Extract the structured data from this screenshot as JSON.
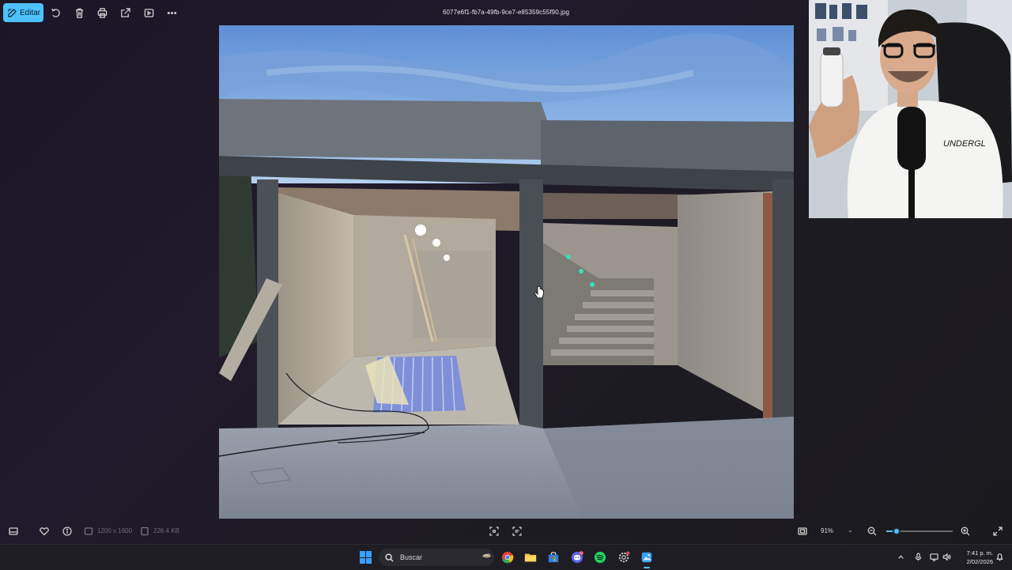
{
  "toolbar": {
    "edit_label": "Editar",
    "icons": [
      "rotate-icon",
      "delete-icon",
      "print-icon",
      "share-icon",
      "slideshow-icon",
      "more-icon"
    ]
  },
  "file": {
    "name": "6077e6f1-fb7a-49fb-9ce7-e85359c55f90.jpg"
  },
  "bottombar": {
    "resolution": "1200 x 1600",
    "size": "226.4 KB",
    "zoom": "91%",
    "zoom_fraction": 0.15
  },
  "taskbar": {
    "search_placeholder": "Buscar",
    "apps": [
      "chrome-icon",
      "file-explorer-icon",
      "store-icon",
      "discord-icon",
      "spotify-icon",
      "settings-icon",
      "photos-icon"
    ],
    "discord_badge": "9+",
    "time": "7:41 p. m.",
    "date": "2/02/2026"
  },
  "webcam": {
    "shirt_text": "UNDERGL"
  },
  "colors": {
    "accent": "#4cc2ff",
    "background": "#1d1a24",
    "taskbar": "#1f1d24"
  }
}
